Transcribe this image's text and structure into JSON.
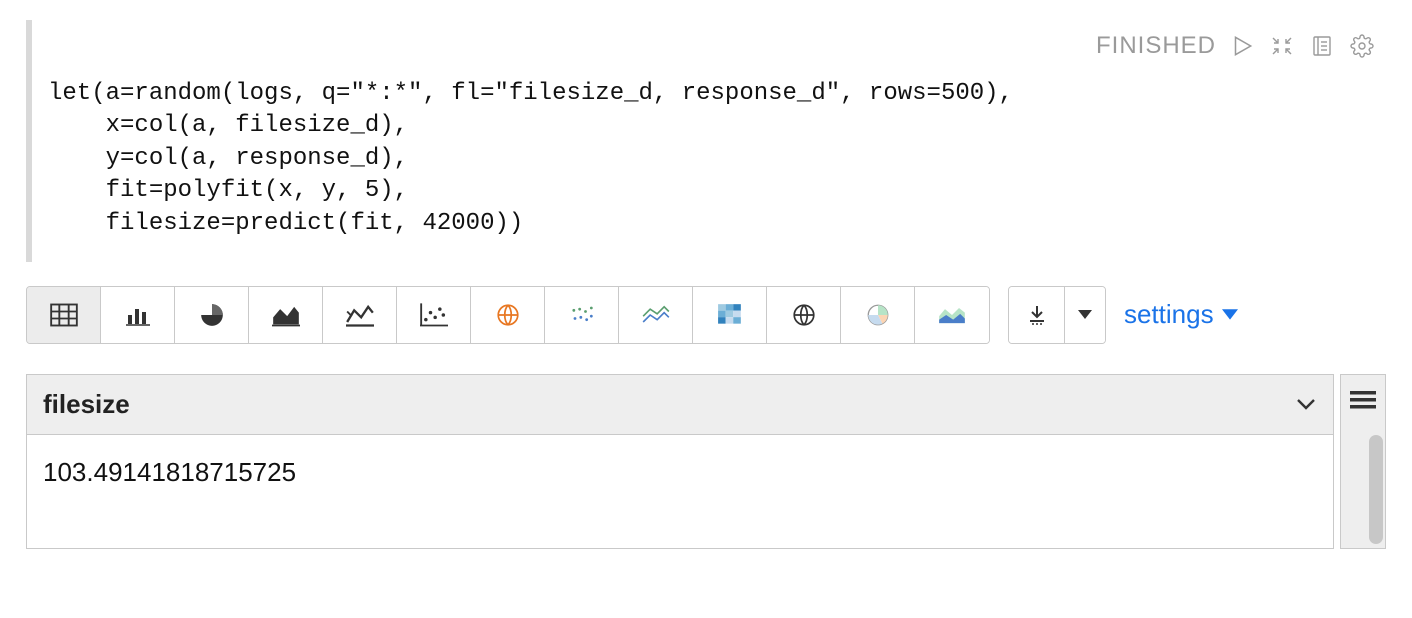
{
  "status": "FINISHED",
  "code": "let(a=random(logs, q=\"*:*\", fl=\"filesize_d, response_d\", rows=500),\n    x=col(a, filesize_d),\n    y=col(a, response_d),\n    fit=polyfit(x, y, 5),\n    filesize=predict(fit, 42000))",
  "settings_label": "settings",
  "table": {
    "header": "filesize",
    "rows": [
      "103.49141818715725"
    ]
  },
  "viz_icons": [
    "table-icon",
    "bar-chart-icon",
    "pie-chart-icon",
    "area-chart-icon",
    "line-chart-icon",
    "scatter-chart-icon",
    "map-marker-icon",
    "bubble-chart-icon",
    "multiline-chart-icon",
    "heatmap-icon",
    "globe-icon",
    "pie-outline-icon",
    "area-outline-icon"
  ]
}
